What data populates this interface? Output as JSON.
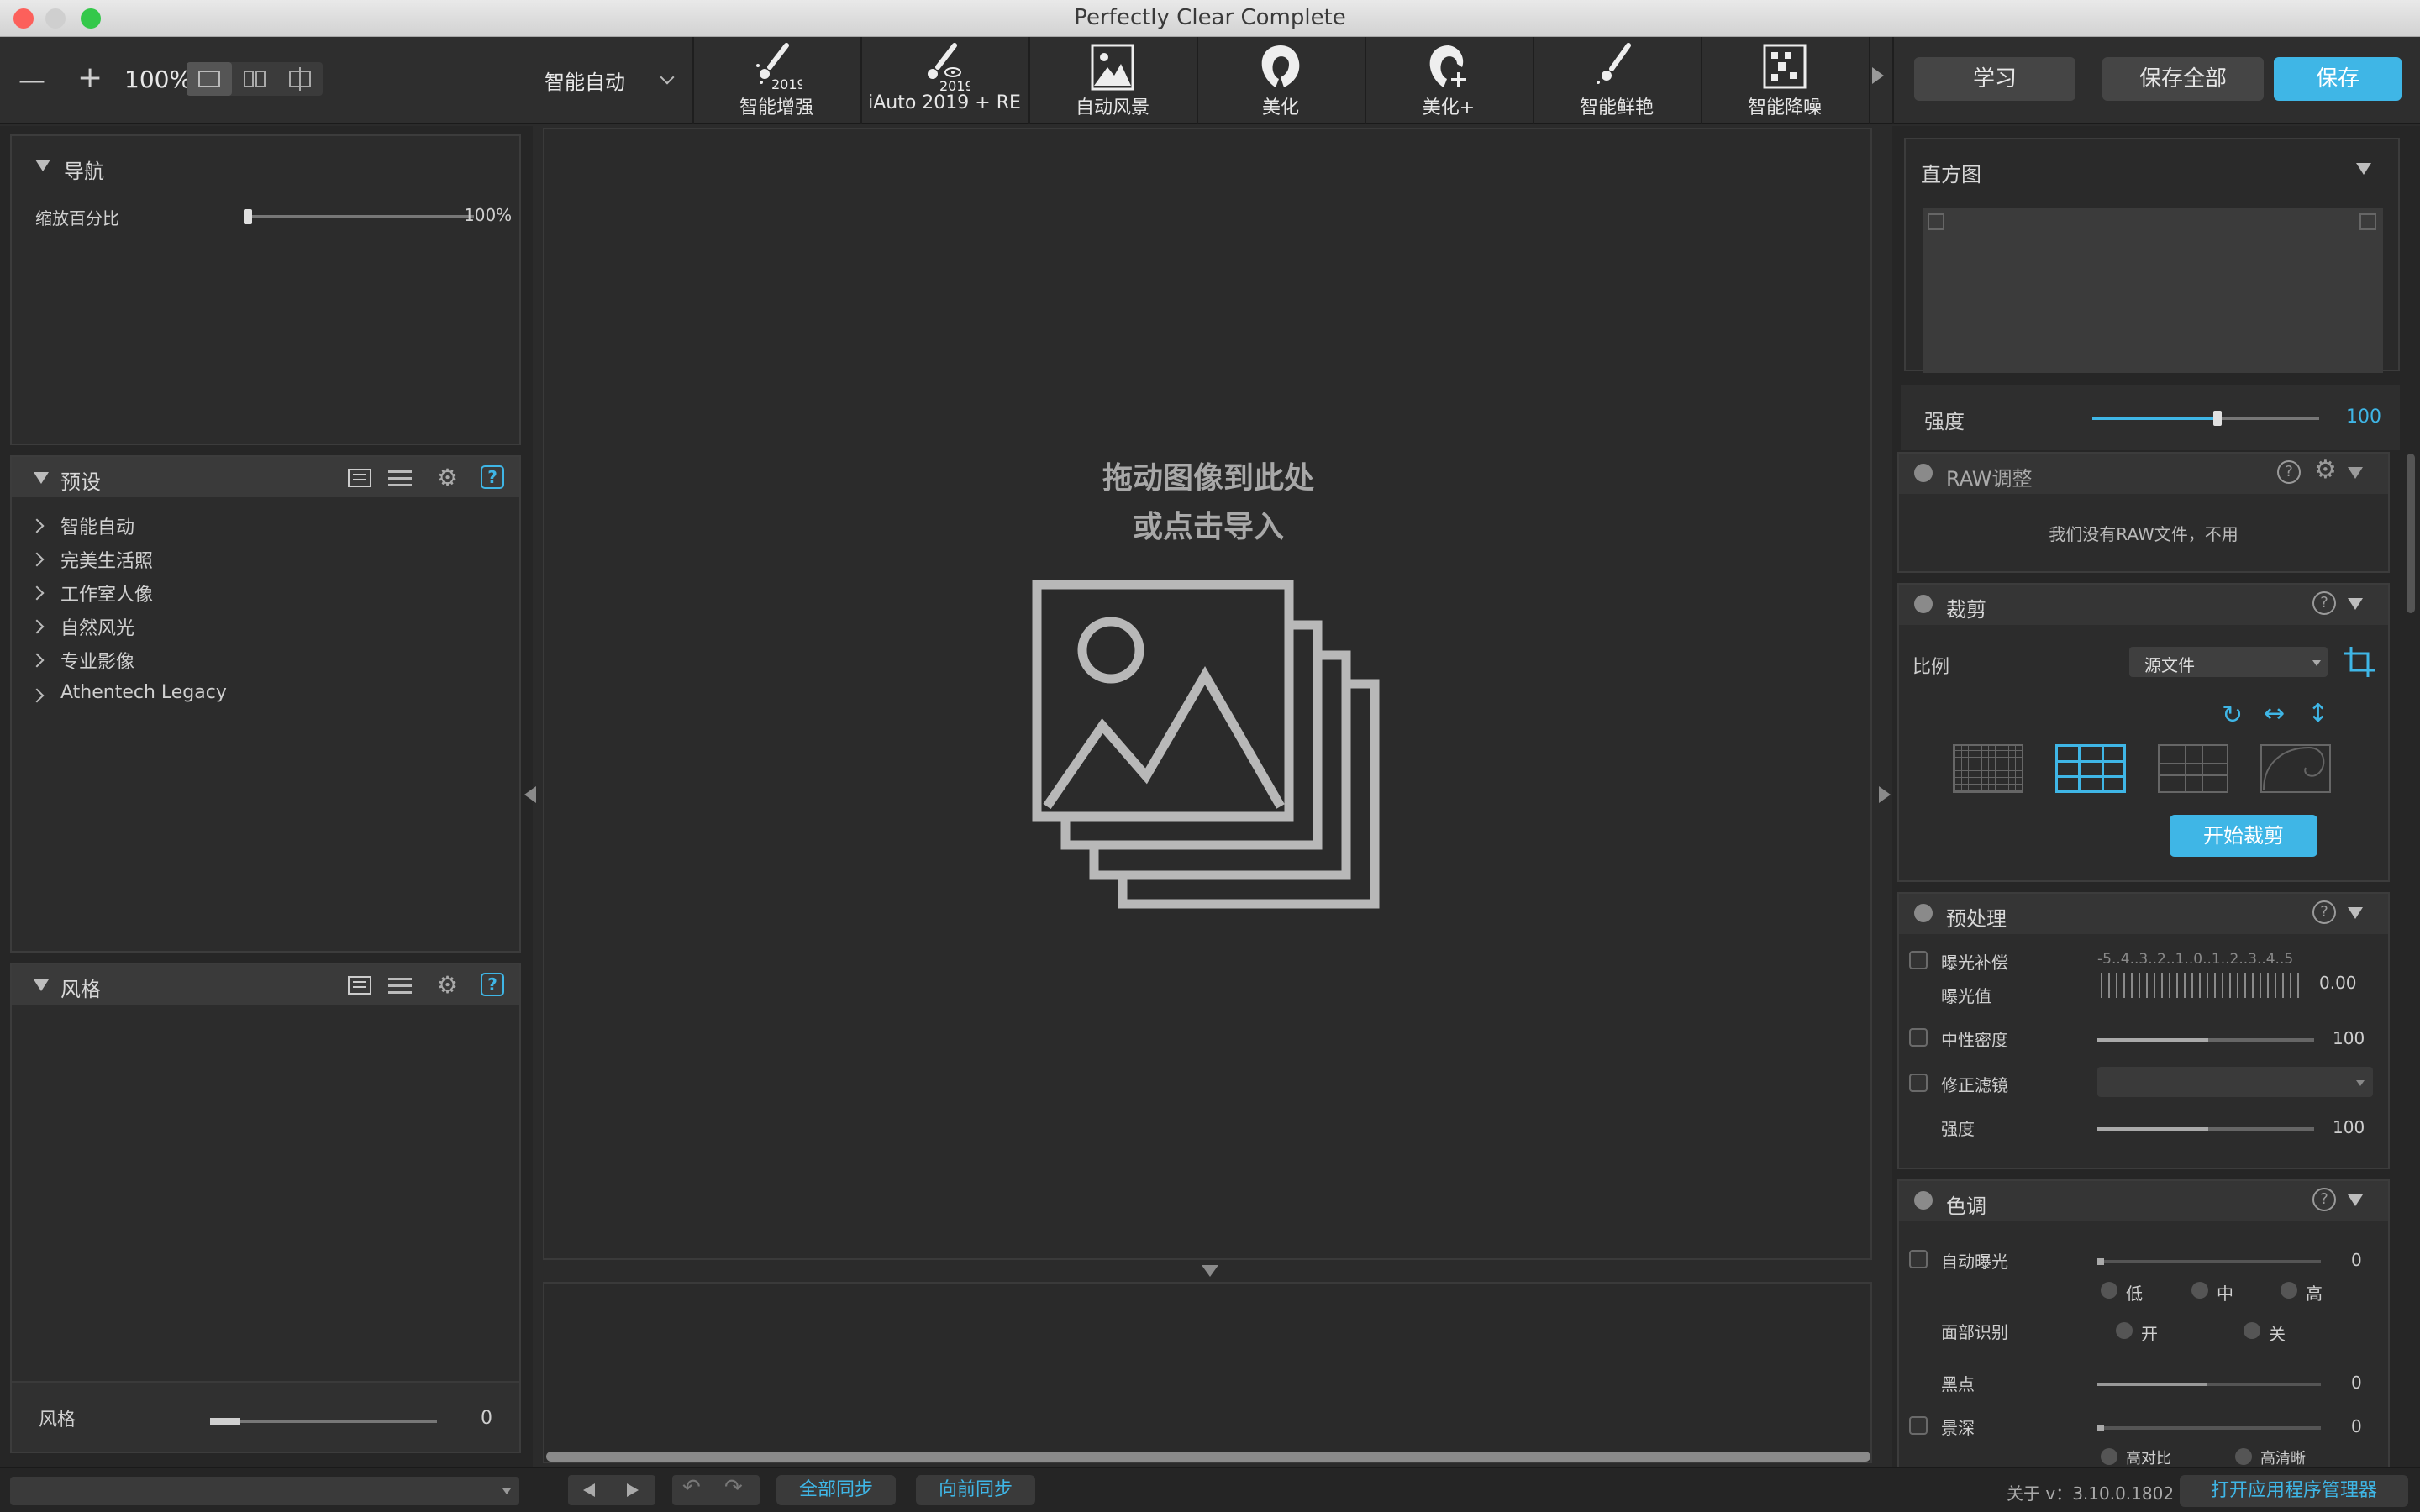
{
  "window": {
    "title": "Perfectly Clear Complete"
  },
  "toolbar": {
    "zoom_minus": "—",
    "zoom_plus": "+",
    "zoom_level": "100%",
    "preset_select": "智能自动",
    "tools": [
      {
        "label": "智能增强",
        "badge": "2019"
      },
      {
        "label": "iAuto 2019 + RE",
        "badge": "2019"
      },
      {
        "label": "自动风景"
      },
      {
        "label": "美化"
      },
      {
        "label": "美化+"
      },
      {
        "label": "智能鲜艳"
      },
      {
        "label": "智能降噪"
      }
    ],
    "learn_label": "学习",
    "save_all_label": "保存全部",
    "save_label": "保存"
  },
  "nav_panel": {
    "title": "导航",
    "zoom_label": "缩放百分比",
    "zoom_value": "100%",
    "zoom_fraction": 0.0
  },
  "presets_panel": {
    "title": "预设",
    "items": [
      "智能自动",
      "完美生活照",
      "工作室人像",
      "自然风光",
      "专业影像",
      "Athentech Legacy"
    ]
  },
  "style_panel": {
    "title": "风格",
    "slider_label": "风格",
    "slider_value": "0"
  },
  "canvas": {
    "drop_line1": "拖动图像到此处",
    "drop_line2": "或点击导入"
  },
  "right": {
    "histogram_title": "直方图",
    "strength_label": "强度",
    "strength_value": "100",
    "strength_fraction": 0.55,
    "raw": {
      "title": "RAW调整",
      "note": "我们没有RAW文件，不用"
    },
    "crop": {
      "title": "裁剪",
      "ratio_label": "比例",
      "ratio_value": "源文件",
      "start_label": "开始裁剪"
    },
    "pre": {
      "title": "预处理",
      "exposure_comp": "曝光补偿",
      "exposure_value_label": "曝光值",
      "exposure_scale": "-5..4..3..2..1..0..1..2..3..4..5",
      "exposure_value": "0.00",
      "nd_label": "中性密度",
      "nd_value": "100",
      "filter_label": "修正滤镜",
      "strength_label": "强度",
      "strength_value": "100"
    },
    "tone": {
      "title": "色调",
      "auto_exposure": "自动曝光",
      "auto_exposure_value": "0",
      "low": "低",
      "mid": "中",
      "high": "高",
      "face_label": "面部识别",
      "on": "开",
      "off": "关",
      "black_label": "黑点",
      "black_value": "0",
      "depth_label": "景深",
      "depth_value": "0",
      "hi_contrast": "高对比",
      "hi_clarity": "高清晰"
    }
  },
  "bottom": {
    "sync_all": "全部同步",
    "sync_forward": "向前同步",
    "about": "关于 v：3.10.0.1802",
    "open_manager": "打开应用程序管理器"
  },
  "colors": {
    "accent": "#3fb6e6",
    "close": "#fc605b",
    "min": "#fdbc40",
    "max": "#34c84a"
  }
}
